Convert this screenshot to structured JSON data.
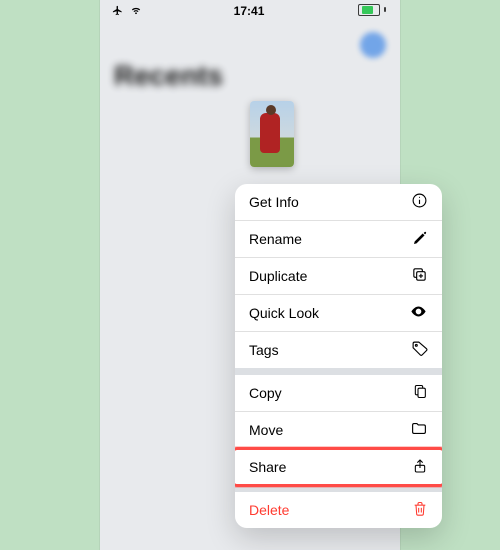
{
  "statusbar": {
    "time": "17:41"
  },
  "page_title_blurred": "Recents",
  "menu": {
    "group1": [
      {
        "label": "Get Info",
        "icon": "info-icon"
      },
      {
        "label": "Rename",
        "icon": "pencil-icon"
      },
      {
        "label": "Duplicate",
        "icon": "duplicate-icon"
      },
      {
        "label": "Quick Look",
        "icon": "eye-icon"
      },
      {
        "label": "Tags",
        "icon": "tag-icon"
      }
    ],
    "group2": [
      {
        "label": "Copy",
        "icon": "copy-icon"
      },
      {
        "label": "Move",
        "icon": "folder-icon"
      },
      {
        "label": "Share",
        "icon": "share-icon",
        "highlighted": true
      }
    ],
    "group3": [
      {
        "label": "Delete",
        "icon": "trash-icon",
        "destructive": true
      }
    ]
  }
}
